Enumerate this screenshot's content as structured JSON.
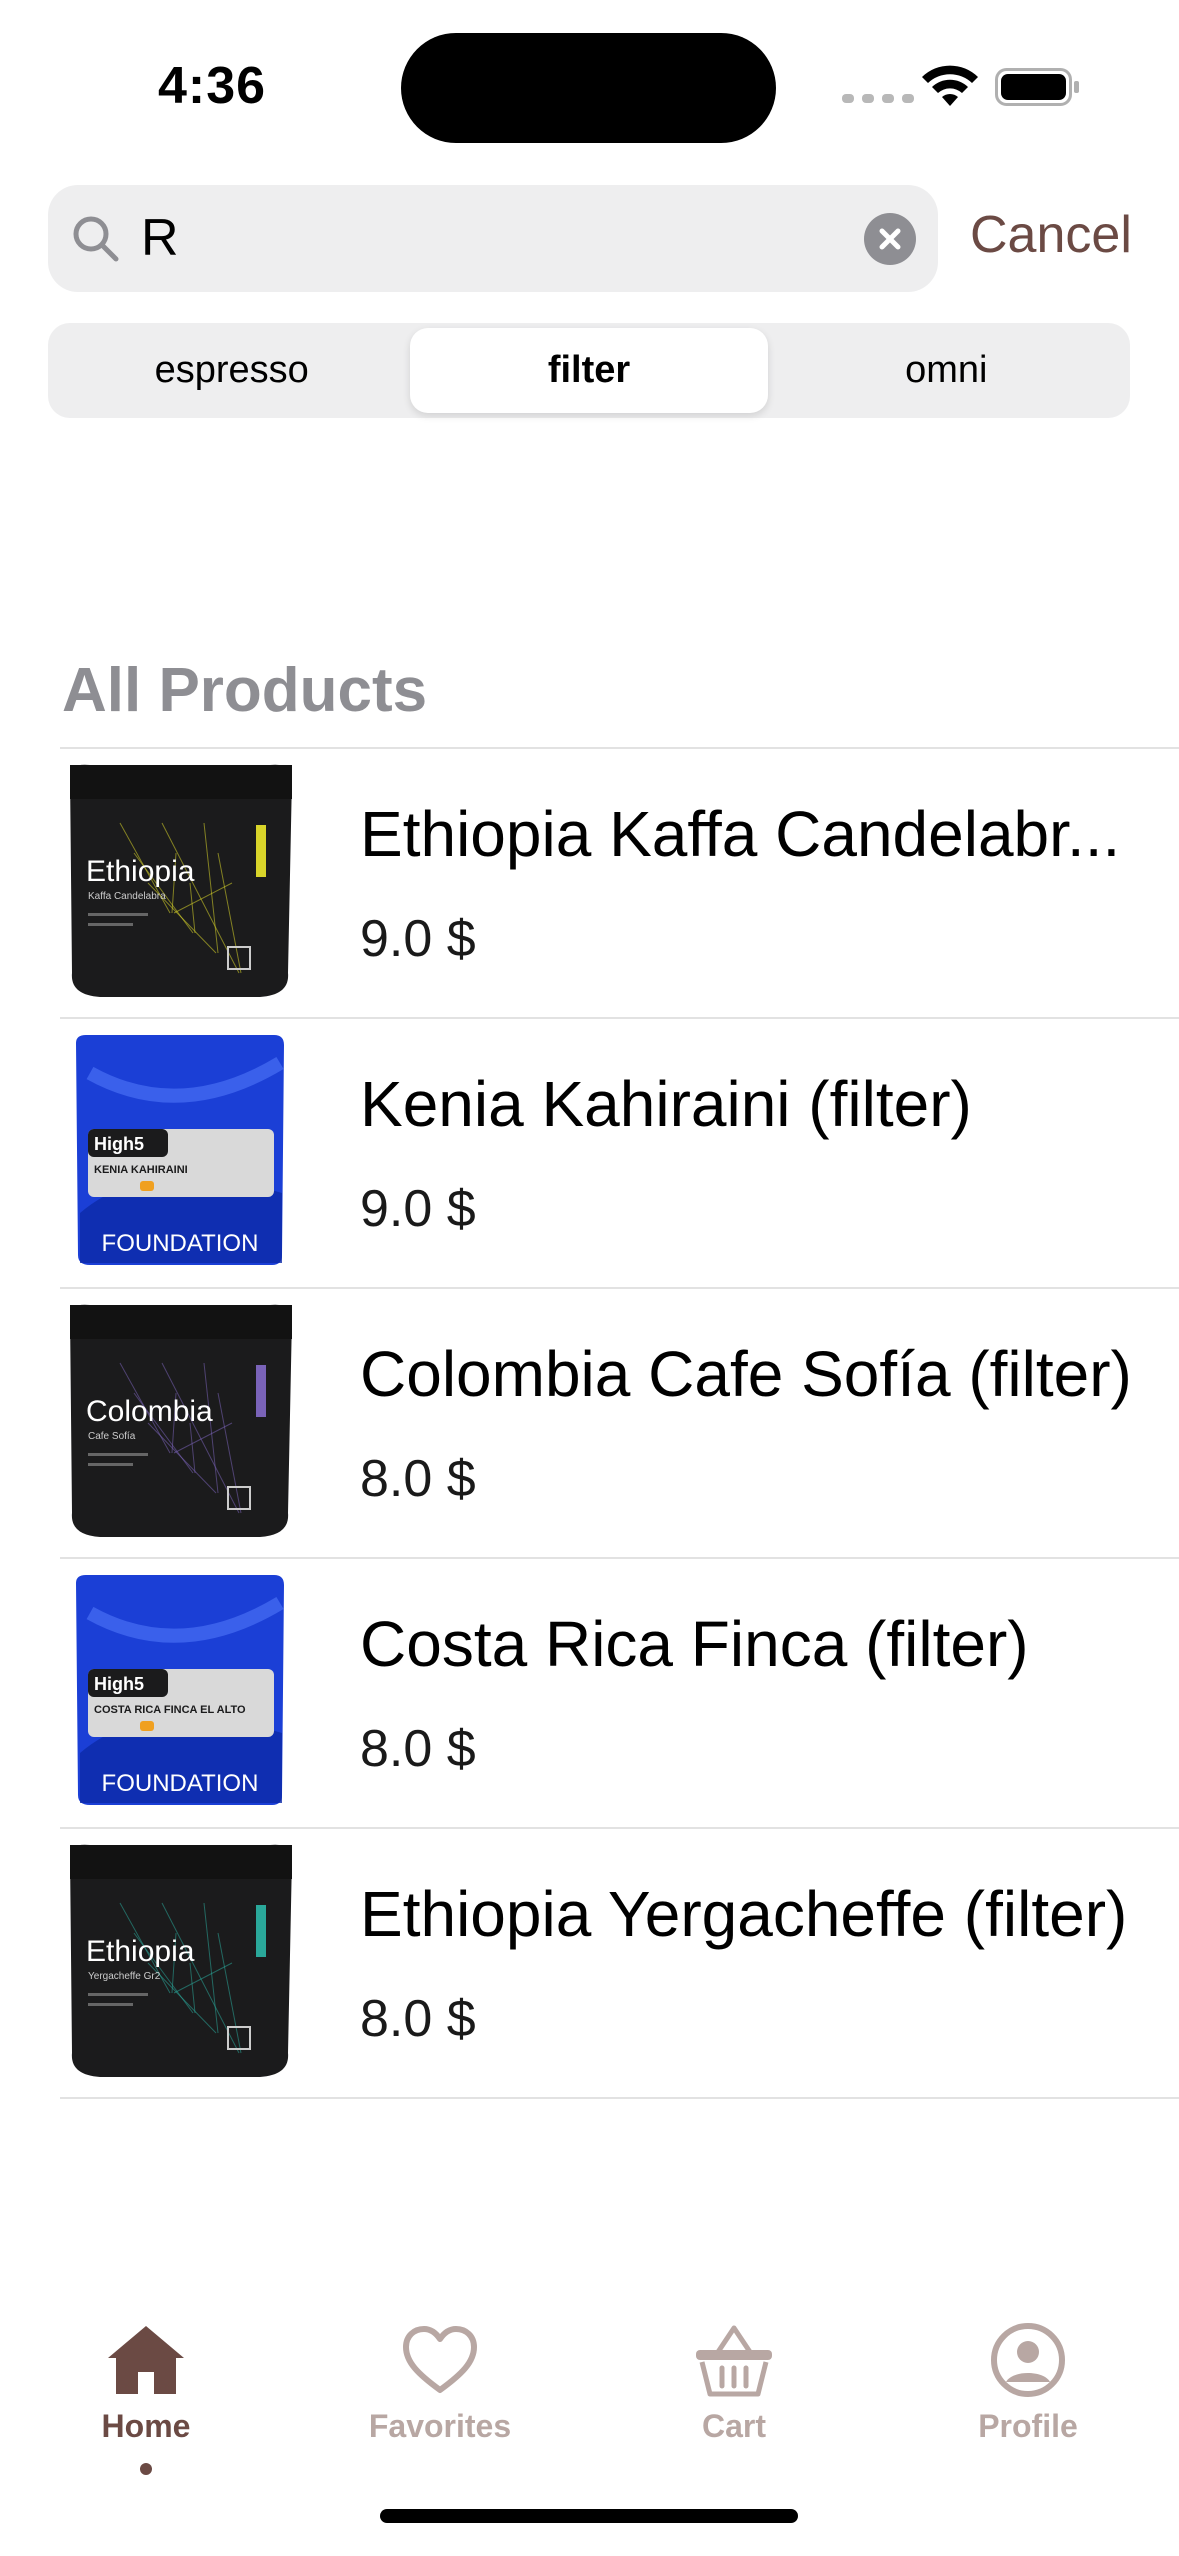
{
  "status_bar": {
    "time": "4:36"
  },
  "search": {
    "value": "R",
    "cancel_label": "Cancel"
  },
  "segments": [
    {
      "label": "espresso",
      "active": false
    },
    {
      "label": "filter",
      "active": true
    },
    {
      "label": "omni",
      "active": false
    }
  ],
  "section_title": "All Products",
  "products": [
    {
      "name": "Ethiopia Kaffa Candelabr...",
      "price": "9.0 $",
      "bag": "dark",
      "bag_title": "Ethiopia",
      "bag_sub": "Kaffa Candelabra",
      "accent": "#d9d52a"
    },
    {
      "name": "Kenia Kahiraini (filter)",
      "price": "9.0 $",
      "bag": "blue",
      "bag_title": "High5",
      "bag_sub": "KENIA KAHIRAINI",
      "accent": "#f0a020"
    },
    {
      "name": "Colombia Cafe Sofía (filter)",
      "price": "8.0 $",
      "bag": "dark",
      "bag_title": "Colombia",
      "bag_sub": "Cafe Sofía",
      "accent": "#7a63b8"
    },
    {
      "name": "Costa Rica Finca (filter)",
      "price": "8.0 $",
      "bag": "blue",
      "bag_title": "High5",
      "bag_sub": "COSTA RICA FINCA EL ALTO",
      "accent": "#f0a020"
    },
    {
      "name": "Ethiopia Yergacheffe (filter)",
      "price": "8.0 $",
      "bag": "dark",
      "bag_title": "Ethiopia",
      "bag_sub": "Yergacheffe Gr2",
      "accent": "#2aa89a"
    }
  ],
  "tabs": [
    {
      "label": "Home",
      "icon": "home-icon",
      "active": true
    },
    {
      "label": "Favorites",
      "icon": "heart-icon",
      "active": false
    },
    {
      "label": "Cart",
      "icon": "basket-icon",
      "active": false
    },
    {
      "label": "Profile",
      "icon": "profile-icon",
      "active": false
    }
  ],
  "colors": {
    "accent": "#6b4a44",
    "inactive_tab": "#b8a7a3",
    "section_gray": "#8e8e93"
  }
}
